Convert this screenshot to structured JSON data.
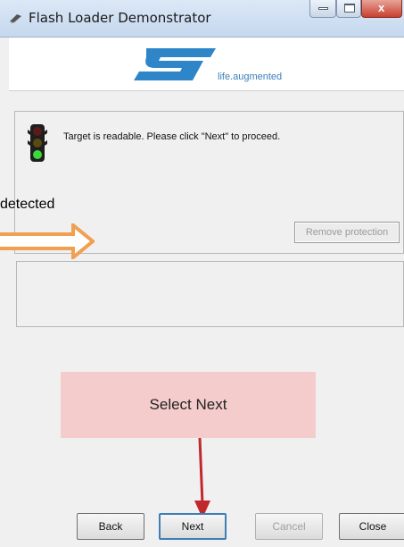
{
  "window": {
    "title": "Flash Loader Demonstrator",
    "close_glyph": "x"
  },
  "logo": {
    "tagline": "life.augmented",
    "brand_color": "#3c7fb8"
  },
  "status": {
    "message": "Target is readable. Please click \"Next\" to proceed.",
    "remove_protection_label": "Remove protection",
    "traffic_light_icon": "traffic-light-green-icon"
  },
  "annotation": {
    "detected_label": "detected",
    "callout_label": "Select Next",
    "callout_color": "#f4cccc",
    "arrow_color_orange": "#f0a050",
    "arrow_color_red": "#c0282c"
  },
  "buttons": {
    "back_label": "Back",
    "next_label": "Next",
    "cancel_label": "Cancel",
    "close_label": "Close"
  }
}
